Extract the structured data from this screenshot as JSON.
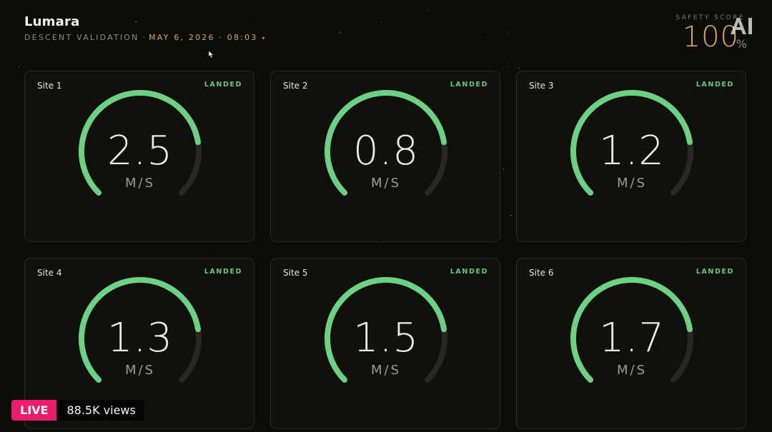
{
  "app": {
    "title": "Lumara",
    "subtitle": "DESCENT VALIDATION",
    "date": "MAY 6, 2026 · 08:03",
    "caret": "▾"
  },
  "score": {
    "label": "SAFETY SCORE",
    "value": "100",
    "unit": "%"
  },
  "gauge": {
    "max": 3.0,
    "track_color": "#2a2822",
    "fill_color": "#6bd183"
  },
  "sites": [
    {
      "name": "Site 1",
      "status": "LANDED",
      "value": "2.5",
      "unit": "M/S",
      "fill_fraction": 0.8
    },
    {
      "name": "Site 2",
      "status": "LANDED",
      "value": "0.8",
      "unit": "M/S",
      "fill_fraction": 0.8
    },
    {
      "name": "Site 3",
      "status": "LANDED",
      "value": "1.2",
      "unit": "M/S",
      "fill_fraction": 0.8
    },
    {
      "name": "Site 4",
      "status": "LANDED",
      "value": "1.3",
      "unit": "M/S",
      "fill_fraction": 0.8
    },
    {
      "name": "Site 5",
      "status": "LANDED",
      "value": "1.5",
      "unit": "M/S",
      "fill_fraction": 0.8
    },
    {
      "name": "Site 6",
      "status": "LANDED",
      "value": "1.7",
      "unit": "M/S",
      "fill_fraction": 0.8
    }
  ],
  "stream": {
    "live_label": "LIVE",
    "views": "88.5K views"
  }
}
